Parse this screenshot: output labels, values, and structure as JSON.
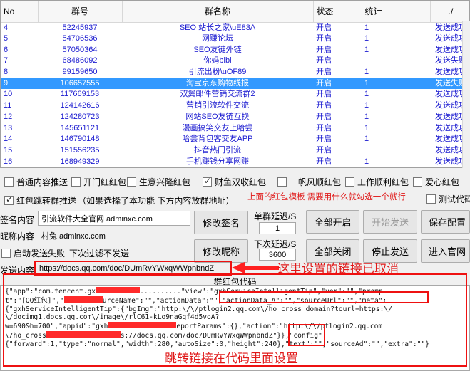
{
  "table": {
    "columns": [
      "No",
      "群号",
      "群名称",
      "状态",
      "统计",
      "./"
    ],
    "rows": [
      {
        "no": "4",
        "id": "52245937",
        "name": "SEO 站长之家\\uE83A",
        "status": "开启",
        "count": "1",
        "result": "发送成功",
        "selected": false
      },
      {
        "no": "5",
        "id": "54706536",
        "name": "网赚论坛",
        "status": "开启",
        "count": "1",
        "result": "发送成功",
        "selected": false
      },
      {
        "no": "6",
        "id": "57050364",
        "name": "SEO友链外链",
        "status": "开启",
        "count": "1",
        "result": "发送成功",
        "selected": false
      },
      {
        "no": "7",
        "id": "68486092",
        "name": "你妈bibi",
        "status": "开启",
        "count": "",
        "result": "发送失败",
        "selected": false
      },
      {
        "no": "8",
        "id": "99159650",
        "name": "引流出粉\\uOF89",
        "status": "开启",
        "count": "1",
        "result": "发送成功",
        "selected": false
      },
      {
        "no": "9",
        "id": "106657555",
        "name": "淘宝京东购物线报",
        "status": "开启",
        "count": "1",
        "result": "发送失败",
        "selected": true
      },
      {
        "no": "10",
        "id": "117669153",
        "name": "双翼邮件营销交流群2",
        "status": "开启",
        "count": "1",
        "result": "发送成功",
        "selected": false
      },
      {
        "no": "11",
        "id": "124142616",
        "name": "营销引流软件交流",
        "status": "开启",
        "count": "1",
        "result": "发送成功",
        "selected": false
      },
      {
        "no": "12",
        "id": "124280723",
        "name": "网站SEO友链互换",
        "status": "开启",
        "count": "1",
        "result": "发送成功",
        "selected": false
      },
      {
        "no": "13",
        "id": "145651121",
        "name": "漫画搞笑交友上哈尝",
        "status": "开启",
        "count": "1",
        "result": "发送成功",
        "selected": false
      },
      {
        "no": "14",
        "id": "146790148",
        "name": "哈尝背包客交友APP",
        "status": "开启",
        "count": "1",
        "result": "发送成功",
        "selected": false
      },
      {
        "no": "15",
        "id": "151556235",
        "name": "抖音热门引流",
        "status": "开启",
        "count": "",
        "result": "发送成功",
        "selected": false
      },
      {
        "no": "16",
        "id": "168949329",
        "name": "手机赚钱分享网赚",
        "status": "开启",
        "count": "1",
        "result": "发送成功",
        "selected": false
      }
    ]
  },
  "checkboxes_row1": [
    {
      "label": "普通内容推送",
      "checked": false
    },
    {
      "label": "开门红红包",
      "checked": false
    },
    {
      "label": "生意兴隆红包",
      "checked": false
    },
    {
      "label": "财鱼双收红包",
      "checked": true
    },
    {
      "label": "一帆风顺红包",
      "checked": false
    },
    {
      "label": "工作顺利红包",
      "checked": false
    },
    {
      "label": "爱心红包",
      "checked": false
    }
  ],
  "redirect_push": {
    "label": "红包跳转群推送",
    "checked": true,
    "hint": "（如果选择了本功能 下方内容放群地址）"
  },
  "annotation_top": "上面的红包模板 需要用什么就勾选一个就行",
  "test_code": {
    "label": "测试代码",
    "checked": false
  },
  "form": {
    "signature_label": "签名内容",
    "signature_value": "引流软件大全官网 adminxc.com",
    "nickname_label": "昵称内容",
    "nickname_value": "村兔 adminxc.com",
    "single_delay_label": "单群延迟/S",
    "single_delay_value": "1",
    "next_delay_label": "下次延迟/S",
    "next_delay_value": "3600",
    "auto_fail_label": "启动发送失败",
    "auto_fail_hint": "下次过滤不发送",
    "send_label": "发送内容",
    "send_value": "https://docs.qq.com/doc/DUmRvYWxqWWpnbndZ"
  },
  "buttons": {
    "modify_signature": "修改签名",
    "modify_nickname": "修改昵称",
    "open_all": "全部开启",
    "close_all": "全部关闭",
    "start_send": "开始发送",
    "stop_send": "停止发送",
    "save_config": "保存配置",
    "enter_site": "进入官网"
  },
  "annotation_link": "这里设置的链接已取消",
  "code_title": "群红包代码",
  "code_lines": [
    "{\"app\":\"com.tencent.gx",
    "t\":\"[QQ红包]\",\"",
    "{\"gxhServiceIntelligentTip\":{\"bgImg\":\"http:\\/\\/ptlogin2.qq.com\\/ho_cross_domain?tourl=https:\\/",
    "\\/docimg1.docs.qq.com\\/image\\/rlC61-kLo9naGqf4d5voA?",
    "w=690&h=700\",\"appid\":\"gxh",
    "\\/ho_cross",
    "{\"forward\":1,\"type\":\"normal\",\"width\":280,\"autoSize\":0,\"height\":240},\"text\":\"\",\"sourceAd\":\"\",\"extra\":\"\"}"
  ],
  "code_fragments": {
    "l1_mid": "\"view\":\"gxhServiceIntelligentTip\",\"ver\":\"\",\"promp",
    "l2_mid": "urceName\":\"\",\"actionData\":\"\",\"actionData_A\":\"\",\"sourceUrl\":\"\",\"meta\":",
    "l5_mid": "eportParams\":{},\"action\":\"http:\\/\\/ptlogin2.qq.com",
    "l6_mid": "s://docs.qq.com/doc/DUmRvYWxqWWpnbndZ\"}},\"config\":"
  },
  "annotation_code": "跳转链接在代码里面设置"
}
